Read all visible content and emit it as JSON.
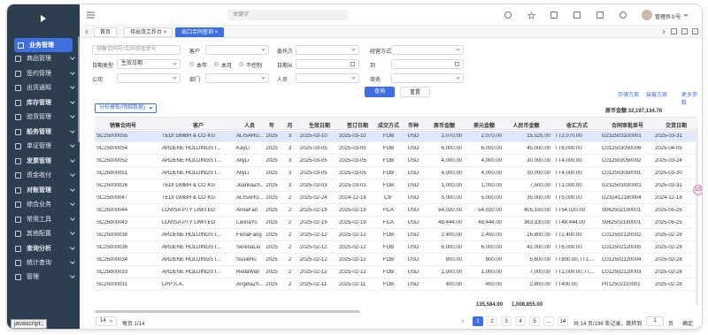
{
  "sidebar": {
    "items": [
      {
        "label": "业务管理",
        "active": true
      },
      {
        "label": "商品管理"
      },
      {
        "label": "签约管理"
      },
      {
        "label": "出货通知"
      },
      {
        "label": "库存管理",
        "bold": true
      },
      {
        "label": "验货管理"
      },
      {
        "label": "船务管理",
        "bold": true
      },
      {
        "label": "单证管理"
      },
      {
        "label": "发票管理",
        "bold": true
      },
      {
        "label": "资金收付"
      },
      {
        "label": "对账管理",
        "bold": true
      },
      {
        "label": "综合业务"
      },
      {
        "label": "常用工具"
      },
      {
        "label": "其他配置"
      },
      {
        "label": "查询分析",
        "bold": true
      },
      {
        "label": "统计查询"
      },
      {
        "label": "管理"
      }
    ],
    "tooltip": "javascript:;"
  },
  "topbar": {
    "search_placeholder": "关键字",
    "user_name": "管理员①号"
  },
  "tabs": [
    {
      "label": "首页"
    },
    {
      "label": "待出货工作台"
    },
    {
      "label": "出口合同查询",
      "active": true
    }
  ],
  "filters": {
    "contract_no_placeholder": "销售合同号/合同审批单号",
    "customer_label": "客户",
    "consignor_label": "委托方",
    "biz_mode_label": "经营方式",
    "date_type_label": "日期类型",
    "date_type_value": "生效日期",
    "radio_year": "本年",
    "radio_month": "本月",
    "radio_none": "不控制",
    "date_from_label": "日期从",
    "date_to_label": "到",
    "company_label": "公司",
    "dept_label": "部门",
    "staff_label": "人员",
    "merch_label": "商务",
    "query_button": "查询",
    "reset_button": "重置",
    "save_plan": "存储方案",
    "load_plan": "装载方案",
    "more_params": "更多参数",
    "template_select": "分析模板(明细数据)",
    "total_label": "原币金额 32,197,134.76"
  },
  "table": {
    "columns": [
      "销售合同号",
      "客户",
      "人员",
      "年",
      "月",
      "生效日期",
      "签订日期",
      "成交方式",
      "币种",
      "原币金额",
      "美元金额",
      "人民币金额",
      "收汇方式",
      "合同审批单号",
      "交货日期"
    ],
    "rows": [
      [
        "SC25000055",
        "TEDI GMBH & CO KG",
        "ALISAHU...",
        "2025",
        "3",
        "2025-03-10",
        "2025-03-10",
        "FOB",
        "USD",
        "2,070.00",
        "2,070.00",
        "15,525.00",
        "TT2,070.00",
        "G232503100001",
        "2025-03-31"
      ],
      [
        "SC25000054",
        "ARDENE HOLDINGS I...",
        "KayLi",
        "2025",
        "3",
        "2025-03-05",
        "2025-03-05",
        "FOB",
        "USD",
        "6,000.00",
        "6,000.00",
        "45,000.00",
        "TT6,000.00",
        "C012503050006",
        "2025-04-05"
      ],
      [
        "SC25000052",
        "ARDENE HOLDINGS I...",
        "AllyLi",
        "2025",
        "3",
        "2025-03-05",
        "2025-03-05",
        "FOB",
        "USD",
        "4,000.00",
        "4,000.00",
        "30,000.00",
        "TT4,000.00",
        "C012503050002",
        "2025-03-24"
      ],
      [
        "SC25000051",
        "ARDENE HOLDINGS I...",
        "AllyLi",
        "2025",
        "3",
        "2025-03-05",
        "2025-03-05",
        "FOB",
        "USD",
        "4,000.00",
        "4,000.00",
        "30,000.00",
        "TT4,000.00",
        "C012503050001",
        "2025-03-30"
      ],
      [
        "SC25000026",
        "TEDI GMBH & CO KG",
        "JoannaZh...",
        "2025",
        "3",
        "2025-03-03",
        "2025-03-03",
        "FOB",
        "USD",
        "1,000.00",
        "1,000.00",
        "7,500.00",
        "TT1,000.00",
        "G232503030001",
        "2025-03-31"
      ],
      [
        "SC25000047",
        "TEDI GMBH & CO KG",
        "ALISAHU...",
        "2025",
        "2",
        "2025-02-24",
        "2024-12-18",
        "CIF",
        "USD",
        "5,000.00",
        "5,000.00",
        "35,000.00",
        "TT5,000.00",
        "G232412180004",
        "2024-12-18"
      ],
      [
        "SC25000044",
        "LOVISA PTY LIMITED",
        "AnitaFan",
        "2025",
        "2",
        "2025-02-19",
        "2025-02-19",
        "FCA",
        "USD",
        "54,020.00",
        "54,020.00",
        "405,150.00",
        "TT54,020.00",
        "S062502190001",
        "2025-05-25"
      ],
      [
        "SC25000043",
        "LOVISA PTY LIMITED",
        "LannaYu",
        "2025",
        "2",
        "2025-02-19",
        "2025-02-19",
        "FCA",
        "USD",
        "48,444.00",
        "48,444.00",
        "363,330.00",
        "TT48,444.00",
        "S062502180001",
        "2025-05-25"
      ],
      [
        "SC25000038",
        "ARDENE HOLDINGS I...",
        "FionaFang",
        "2025",
        "2",
        "2025-02-12",
        "2025-02-12",
        "FOB",
        "USD",
        "2,400.00",
        "2,400.00",
        "16,800.00",
        "TT2,400.00",
        "C012502120002",
        "2025-02-28"
      ],
      [
        "SC25000036",
        "ARDENE HOLDINGS I...",
        "SerenaLiu",
        "2025",
        "2",
        "2025-02-12",
        "2025-02-12",
        "FOB",
        "USD",
        "6,000.00",
        "6,000.00",
        "42,000.00",
        "TT6,000.00",
        "C012502120005",
        "2025-02-28"
      ],
      [
        "SC25000034",
        "ARDENE HOLDINGS I...",
        "SusieHu",
        "2025",
        "2",
        "2025-02-12",
        "2025-02-12",
        "FOB",
        "USD",
        "800.00",
        "800.00",
        "5,600.00",
        "TT800.00,TT1,...",
        "C012502120004",
        "2025-02-28"
      ],
      [
        "SC25000033",
        "ARDENE HOLDINGS I...",
        "RedaWan",
        "2025",
        "2",
        "2025-02-12",
        "2025-02-12",
        "FOB",
        "USD",
        "1,000.00",
        "1,000.00",
        "7,000.00",
        "TT1,000.00,TT...",
        "C012502120003",
        "2025-02-28"
      ],
      [
        "SC25000031",
        "LPP S.A.",
        "AngelaZh...",
        "2025",
        "2",
        "2025-02-11",
        "2025-02-11",
        "FOB",
        "USD",
        "400.00",
        "400.00",
        "2,800.00",
        "TT400.00",
        "P012502110001",
        "2025-02-28"
      ]
    ],
    "totals": {
      "usd": "135,584.00",
      "rmb": "1,008,855.00"
    }
  },
  "pager": {
    "page_size": "14",
    "per_page_text": "每页 1/14",
    "pages": [
      "1",
      "2",
      "3",
      "4",
      "5",
      "...",
      "14"
    ],
    "summary": "共 14 页/196 条记录，跳转到",
    "jump_value": "1",
    "page_unit": "页",
    "confirm": "确定"
  },
  "chip": "1/5"
}
